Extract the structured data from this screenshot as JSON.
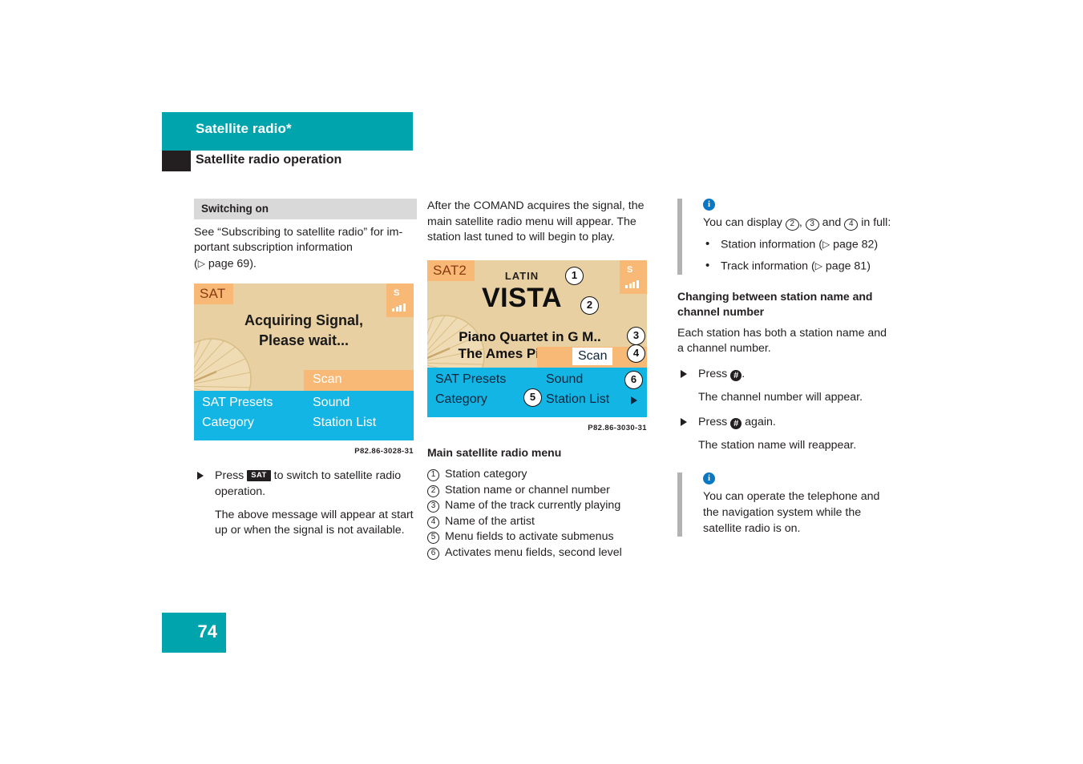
{
  "header": {
    "chapter_title": "Satellite radio*",
    "section_title": "Satellite radio operation",
    "band_color": "#00a4ad",
    "tab_color": "#231f20"
  },
  "column1": {
    "sub_head": "Switching on",
    "intro_line1": "See “Subscribing to satellite radio” for im-",
    "intro_line2": "portant subscription information",
    "intro_line3_pre": "(",
    "intro_line3_tri": "▷",
    "intro_line3_post": " page 69).",
    "display": {
      "source_tag": "SAT",
      "signal_letter": "S",
      "message_line1": "Acquiring Signal,",
      "message_line2": "Please wait...",
      "scan_label": "Scan",
      "menu": {
        "top_left": "SAT Presets",
        "bottom_left": "Category",
        "top_right": "Sound",
        "bottom_right": "Station List"
      }
    },
    "caption": "P82.86-3028-31",
    "step1_pre": "Press ",
    "step1_key": "SAT",
    "step1_post": " to switch to satellite radio operation.",
    "note1": "The above message will appear at start up or when the signal is not available."
  },
  "column2": {
    "intro": "After the COMAND acquires the signal, the main satellite radio menu will appear. The station last tuned to will begin to play.",
    "display": {
      "source_tag": "SAT2",
      "signal_letter": "S",
      "category": "LATIN",
      "station": "VISTA",
      "track": "Piano Quartet in G M..",
      "artist": "The Ames Piano Qua..",
      "scan_label": "Scan",
      "menu": {
        "top_left": "SAT Presets",
        "bottom_left": "Category",
        "top_right": "Sound",
        "bottom_right": "Station List"
      },
      "callouts": [
        "1",
        "2",
        "3",
        "4",
        "5",
        "6"
      ]
    },
    "caption": "P82.86-3030-31",
    "legend_title": "Main satellite radio menu",
    "legend": [
      {
        "n": "1",
        "text": "Station category"
      },
      {
        "n": "2",
        "text": "Station name or channel number"
      },
      {
        "n": "3",
        "text": "Name of the track currently playing"
      },
      {
        "n": "4",
        "text": "Name of the artist"
      },
      {
        "n": "5",
        "text": "Menu fields to activate submenus"
      },
      {
        "n": "6",
        "text": "Activates menu fields, second level"
      }
    ]
  },
  "column3": {
    "info1": {
      "badge": "i",
      "lead_pre": "You can display ",
      "lead_n1": "2",
      "lead_mid1": ", ",
      "lead_n2": "3",
      "lead_mid2": " and ",
      "lead_n3": "4",
      "lead_post": " in full:",
      "bullets": [
        {
          "text_pre": "Station information (",
          "tri": "▷",
          "text_post": " page 82)"
        },
        {
          "text_pre": "Track information (",
          "tri": "▷",
          "text_post": " page 81)"
        }
      ]
    },
    "heading": "Changing between station name and channel number",
    "body": "Each station has both a station name and a channel number.",
    "step1_pre": "Press ",
    "step1_key": "#",
    "step1_post": ".",
    "note1": "The channel number will appear.",
    "step2_pre": "Press ",
    "step2_key": "#",
    "step2_post": " again.",
    "note2": "The station name will reappear.",
    "info2": {
      "badge": "i",
      "text": "You can operate the telephone and the navigation system while the satellite radio is on."
    }
  },
  "footer": {
    "page_number": "74"
  }
}
